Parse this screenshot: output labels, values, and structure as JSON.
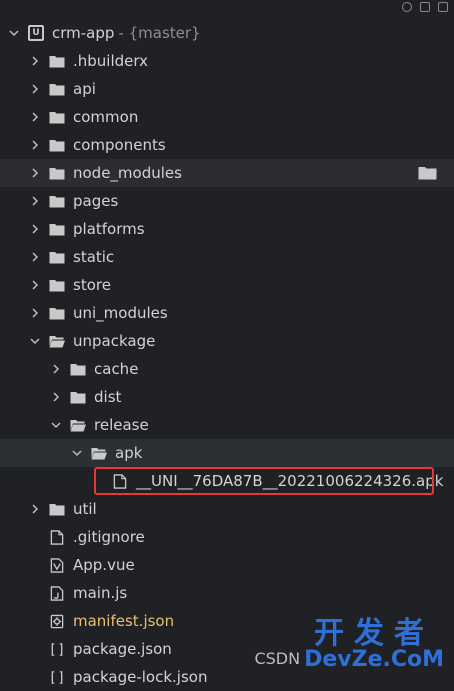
{
  "project": {
    "name": "crm-app",
    "branch": "- {master}"
  },
  "tree": [
    {
      "label": ".hbuilderx",
      "type": "folder",
      "indent": 1,
      "expanded": false
    },
    {
      "label": "api",
      "type": "folder",
      "indent": 1,
      "expanded": false
    },
    {
      "label": "common",
      "type": "folder",
      "indent": 1,
      "expanded": false
    },
    {
      "label": "components",
      "type": "folder",
      "indent": 1,
      "expanded": false
    },
    {
      "label": "node_modules",
      "type": "folder",
      "indent": 1,
      "expanded": false,
      "hover": true
    },
    {
      "label": "pages",
      "type": "folder",
      "indent": 1,
      "expanded": false
    },
    {
      "label": "platforms",
      "type": "folder",
      "indent": 1,
      "expanded": false
    },
    {
      "label": "static",
      "type": "folder",
      "indent": 1,
      "expanded": false
    },
    {
      "label": "store",
      "type": "folder",
      "indent": 1,
      "expanded": false
    },
    {
      "label": "uni_modules",
      "type": "folder",
      "indent": 1,
      "expanded": false
    },
    {
      "label": "unpackage",
      "type": "folder",
      "indent": 1,
      "expanded": true
    },
    {
      "label": "cache",
      "type": "folder",
      "indent": 2,
      "expanded": false
    },
    {
      "label": "dist",
      "type": "folder",
      "indent": 2,
      "expanded": false
    },
    {
      "label": "release",
      "type": "folder",
      "indent": 2,
      "expanded": true
    },
    {
      "label": "apk",
      "type": "folder",
      "indent": 3,
      "expanded": true,
      "selected": true
    },
    {
      "label": "__UNI__76DA87B__20221006224326.apk",
      "type": "file",
      "indent": 4,
      "highlight": true
    },
    {
      "label": "util",
      "type": "folder",
      "indent": 1,
      "expanded": false
    },
    {
      "label": ".gitignore",
      "type": "file",
      "indent": 1
    },
    {
      "label": "App.vue",
      "type": "vue",
      "indent": 1
    },
    {
      "label": "main.js",
      "type": "js",
      "indent": 1
    },
    {
      "label": "manifest.json",
      "type": "manifest",
      "indent": 1,
      "yellow": true
    },
    {
      "label": "package.json",
      "type": "json",
      "indent": 1
    },
    {
      "label": "package-lock.json",
      "type": "json",
      "indent": 1
    }
  ],
  "icons": {
    "folder": "folder-icon",
    "file": "file-icon",
    "vue": "vue-file-icon",
    "js": "js-file-icon",
    "manifest": "manifest-icon",
    "json": "json-file-icon"
  },
  "colors": {
    "background": "#1f2124",
    "text": "#d3d3d3",
    "highlight_border": "#e53935",
    "manifest_text": "#e8c170"
  },
  "watermark": {
    "csdn": "CSDN",
    "cn": "开发者",
    "en": "DevZe.CoM"
  }
}
